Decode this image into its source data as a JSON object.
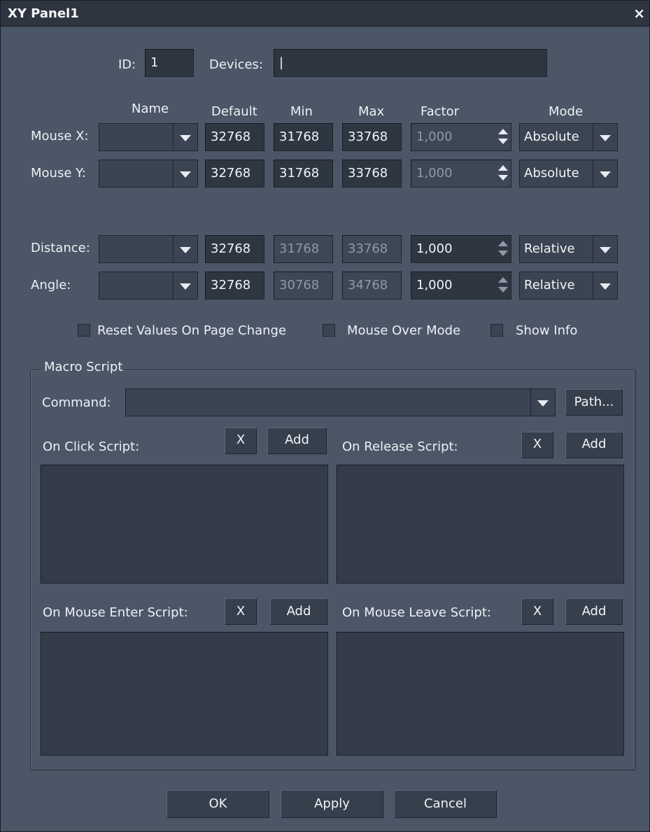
{
  "window": {
    "title": "XY Panel1",
    "close_glyph": "×"
  },
  "header": {
    "id_label": "ID:",
    "id_value": "1",
    "devices_label": "Devices:",
    "devices_value": "|"
  },
  "columns": {
    "name": "Name",
    "default": "Default",
    "min": "Min",
    "max": "Max",
    "factor": "Factor",
    "mode": "Mode"
  },
  "rows": [
    {
      "label": "Mouse X:",
      "default": "32768",
      "min": "31768",
      "max": "33768",
      "factor": "1,000",
      "mode": "Absolute"
    },
    {
      "label": "Mouse Y:",
      "default": "32768",
      "min": "31768",
      "max": "33768",
      "factor": "1,000",
      "mode": "Absolute"
    },
    {
      "label": "Distance:",
      "default": "32768",
      "min": "31768",
      "max": "33768",
      "factor": "1,000",
      "mode": "Relative"
    },
    {
      "label": "Angle:",
      "default": "32768",
      "min": "30768",
      "max": "34768",
      "factor": "1,000",
      "mode": "Relative"
    }
  ],
  "options": {
    "reset_values": "Reset Values On Page Change",
    "mouse_over": "Mouse Over Mode",
    "show_info": "Show Info"
  },
  "macro": {
    "group_title": "Macro Script",
    "command_label": "Command:",
    "command_value": "",
    "path_button": "Path...",
    "on_click": "On Click Script:",
    "on_release": "On Release Script:",
    "on_enter": "On Mouse Enter Script:",
    "on_leave": "On Mouse Leave Script:",
    "clear_label": "X",
    "add_label": "Add"
  },
  "footer": {
    "ok": "OK",
    "apply": "Apply",
    "cancel": "Cancel"
  },
  "icons": {
    "dropdown": "chevron-down-icon",
    "spinner": "spinner-arrows-icon",
    "close": "close-icon"
  }
}
